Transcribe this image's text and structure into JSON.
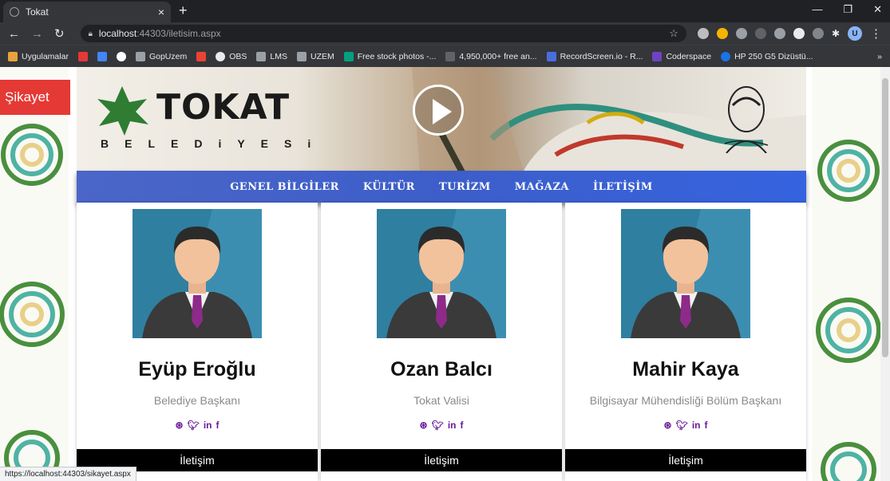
{
  "browser": {
    "tab_title": "Tokat",
    "tab_close": "×",
    "new_tab": "+",
    "window_controls": [
      "—",
      "❐",
      "✕"
    ],
    "url_host": "localhost",
    "url_path": ":44303/iletisim.aspx",
    "profile_initial": "U",
    "bookmarks": [
      {
        "label": "Uygulamalar",
        "color": "#e8a33d"
      },
      {
        "label": "",
        "color": "#e53935"
      },
      {
        "label": "",
        "color": "#4285f4"
      },
      {
        "label": "",
        "color": "#ffffff"
      },
      {
        "label": "GopUzem",
        "color": "#9aa0a6"
      },
      {
        "label": "",
        "color": "#ea4335"
      },
      {
        "label": "OBS",
        "color": "#e8eaed"
      },
      {
        "label": "LMS",
        "color": "#9aa0a6"
      },
      {
        "label": "UZEM",
        "color": "#9aa0a6"
      },
      {
        "label": "Free stock photos -...",
        "color": "#05a081"
      },
      {
        "label": "4,950,000+ free an...",
        "color": "#2e2e2e"
      },
      {
        "label": "RecordScreen.io - R...",
        "color": "#4a6ee0"
      },
      {
        "label": "Coderspace",
        "color": "#6f42c1"
      },
      {
        "label": "HP 250 G5 Dizüstü...",
        "color": "#1a73e8"
      }
    ],
    "bookmarks_more": "»"
  },
  "page": {
    "complaint_button": "Şikayet",
    "logo_title": "TOKAT",
    "logo_subtitle": "BELEDiYESi",
    "nav": [
      "GENEL BİLGİLER",
      "KÜLTÜR",
      "TURİZM",
      "MAĞAZA",
      "İLETİŞİM"
    ],
    "cards": [
      {
        "name": "Eyüp Eroğlu",
        "role": "Belediye Başkanı",
        "button": "İletişim"
      },
      {
        "name": "Ozan Balcı",
        "role": "Tokat Valisi",
        "button": "İletişim"
      },
      {
        "name": "Mahir Kaya",
        "role": "Bilgisayar Mühendisliği Bölüm Başkanı",
        "button": "İletişim"
      }
    ],
    "social": [
      "⊛",
      "🐦",
      "in",
      "f"
    ],
    "status_url": "https://localhost:44303/sikayet.aspx",
    "colors": {
      "nav": "#3d5ec9",
      "complaint": "#e53935",
      "social": "#6a1b9a"
    }
  }
}
